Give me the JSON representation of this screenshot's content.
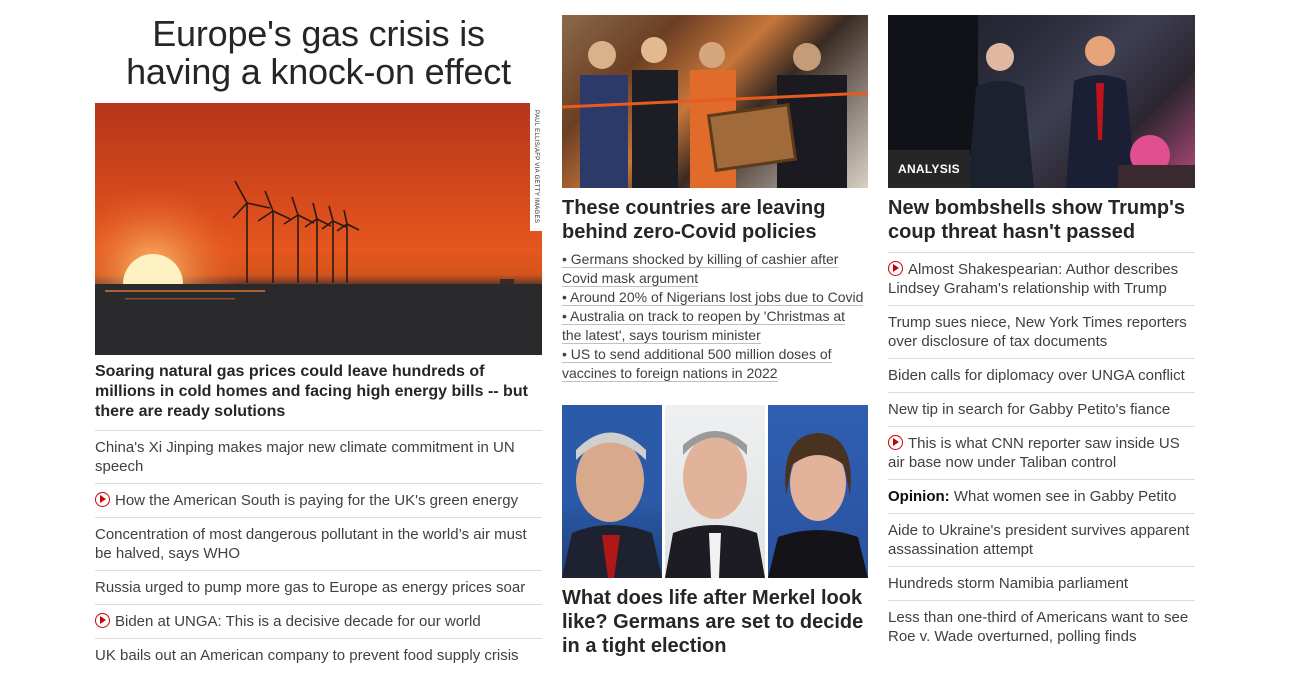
{
  "col1": {
    "headline": "Europe's gas crisis is having a knock-on effect",
    "photo_credit": "PAUL ELLIS/AFP VIA GETTY IMAGES",
    "lead": "Soaring natural gas prices could leave hundreds of millions in cold homes and facing high energy bills -- but there are ready solutions",
    "items": [
      {
        "text": "China's Xi Jinping makes major new climate commitment in UN speech",
        "video": false
      },
      {
        "text": "How the American South is paying for the UK's green energy",
        "video": true
      },
      {
        "text": "Concentration of most dangerous pollutant in the world’s air must be halved, says WHO",
        "video": false
      },
      {
        "text": "Russia urged to pump more gas to Europe as energy prices soar",
        "video": false
      },
      {
        "text": "Biden at UNGA: This is a decisive decade for our world",
        "video": true
      },
      {
        "text": "UK bails out an American company to prevent food supply crisis",
        "video": false
      }
    ]
  },
  "col2": {
    "story1": {
      "headline": "These countries are leaving behind zero-Covid policies",
      "bullets": [
        "• Germans shocked by killing of cashier after Covid mask argument",
        "• Around 20% of Nigerians lost jobs due to Covid",
        "• Australia on track to reopen by 'Christmas at the latest', says tourism minister",
        "• US to send additional 500 million doses of vaccines to foreign nations in 2022"
      ]
    },
    "story2": {
      "headline": "What does life after Merkel look like? Germans are set to decide in a tight election"
    }
  },
  "col3": {
    "badge": "ANALYSIS",
    "headline": "New bombshells show Trump's coup threat hasn't passed",
    "items": [
      {
        "text": "Almost Shakespearian: Author describes Lindsey Graham's relationship with Trump",
        "video": true,
        "opinion": ""
      },
      {
        "text": "Trump sues niece, New York Times reporters over disclosure of tax documents",
        "video": false,
        "opinion": ""
      },
      {
        "text": "Biden calls for diplomacy over UNGA conflict",
        "video": false,
        "opinion": ""
      },
      {
        "text": "New tip in search for Gabby Petito's fiance",
        "video": false,
        "opinion": ""
      },
      {
        "text": "This is what CNN reporter saw inside US air base now under Taliban control",
        "video": true,
        "opinion": ""
      },
      {
        "text": "What women see in Gabby Petito",
        "video": false,
        "opinion": "Opinion:"
      },
      {
        "text": "Aide to Ukraine's president survives apparent assassination attempt",
        "video": false,
        "opinion": ""
      },
      {
        "text": "Hundreds storm Namibia parliament",
        "video": false,
        "opinion": ""
      },
      {
        "text": "Less than one-third of Americans want to see Roe v. Wade overturned, polling finds",
        "video": false,
        "opinion": ""
      }
    ]
  },
  "colors": {
    "video_red": "#cc0000",
    "text_dark": "#0c0c0c",
    "text_body": "#404040",
    "divider": "#dcdcdc"
  }
}
